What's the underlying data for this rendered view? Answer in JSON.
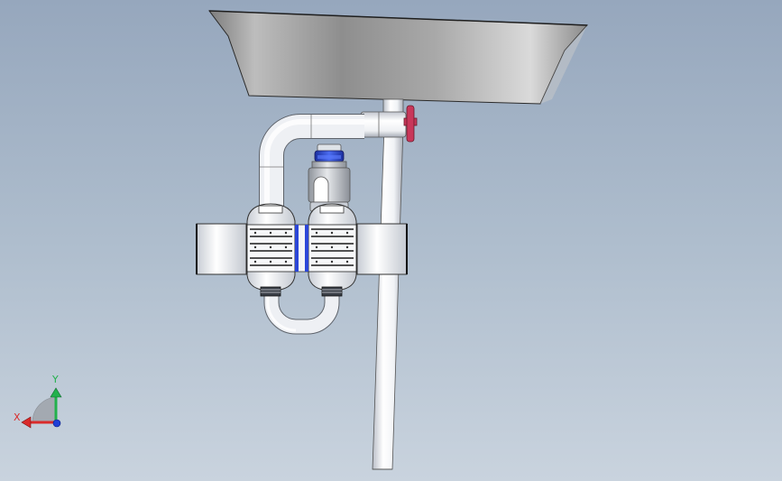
{
  "triad": {
    "x_label": "X",
    "y_label": "Y",
    "x_color": "#d92b2b",
    "y_color": "#22b14c",
    "z_color": "#1f3fd6"
  },
  "colors": {
    "background_top": "#96a7bd",
    "background_bottom": "#c9d3de",
    "pipe": "#eef0f4",
    "sink": "#9a9a9a",
    "valve_handle": "#c8375a",
    "filter_blue": "#2b46d8",
    "cap_blue": "#2255c8"
  }
}
